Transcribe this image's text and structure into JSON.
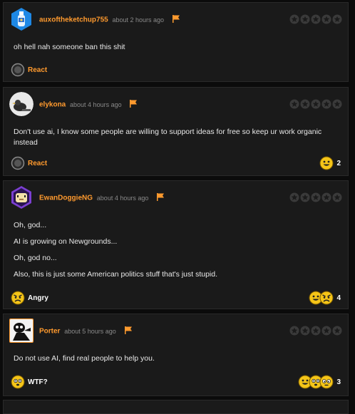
{
  "colors": {
    "accent": "#ff9a2e",
    "card_bg": "#1a1a1a",
    "page_bg": "#0b0b0b"
  },
  "comments": [
    {
      "username": "auxoftheketchup755",
      "time": "about 2 hours ago",
      "avatar_icon": "ketchup-bottle-hexagon-avatar",
      "paragraphs": [
        "oh hell nah someone ban this shit"
      ],
      "reaction_label": "React",
      "reaction_icon": "react-circle-icon",
      "reaction_count": ""
    },
    {
      "username": "elykona",
      "time": "about 4 hours ago",
      "avatar_icon": "bird-photo-avatar",
      "paragraphs": [
        "Don't use ai, I know some people are willing to support ideas for free so keep ur work organic instead"
      ],
      "reaction_label": "React",
      "reaction_icon": "react-circle-icon",
      "reaction_count": "2"
    },
    {
      "username": "EwanDoggieNG",
      "time": "about 4 hours ago",
      "avatar_icon": "purple-hexagon-character-avatar",
      "paragraphs": [
        "Oh, god...",
        "AI is growing on Newgrounds...",
        "Oh, god no...",
        "Also, this is just some American politics stuff that's just stupid."
      ],
      "reaction_label": "Angry",
      "reaction_icon": "angry-face-icon",
      "reaction_count": "4"
    },
    {
      "username": "Porter",
      "time": "about 5 hours ago",
      "avatar_icon": "cartoon-character-avatar",
      "paragraphs": [
        "Do not use AI, find real people to help you."
      ],
      "reaction_label": "WTF?",
      "reaction_icon": "wtf-face-icon",
      "reaction_count": "3"
    }
  ]
}
